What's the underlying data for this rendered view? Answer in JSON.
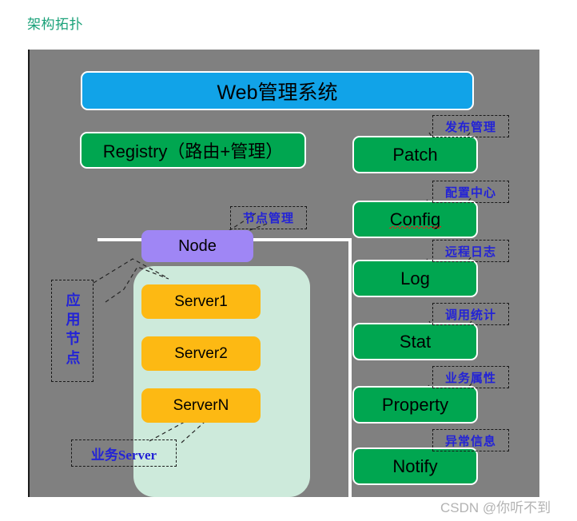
{
  "page": {
    "title": "架构拓扑",
    "title_color": "#1aa179",
    "watermark": "CSDN @你听不到"
  },
  "canvas": {
    "background_color": "#808080"
  },
  "colors": {
    "blue": "#11a3e8",
    "green": "#00a650",
    "orange": "#fdb913",
    "purple": "#9f86f5",
    "mint": "#cdeadb",
    "callout_text": "#2323d6",
    "spellcheck": "#e02020"
  },
  "header": {
    "label": "Web管理系统"
  },
  "registry": {
    "label": "Registry（路由+管理）"
  },
  "app_node": {
    "node": "Node",
    "servers": [
      "Server1",
      "Server2",
      "ServerN"
    ],
    "side_label": "应用节点",
    "bottom_label": "业务Server",
    "node_callout": "节点管理"
  },
  "services": [
    {
      "label": "Patch",
      "callout": "发布管理",
      "spellcheck": false
    },
    {
      "label": "Config",
      "callout": "配置中心",
      "spellcheck": true
    },
    {
      "label": "Log",
      "callout": "远程日志",
      "spellcheck": false
    },
    {
      "label": "Stat",
      "callout": "调用统计",
      "spellcheck": false
    },
    {
      "label": "Property",
      "callout": "业务属性",
      "spellcheck": false
    },
    {
      "label": "Notify",
      "callout": "异常信息",
      "spellcheck": false
    }
  ]
}
